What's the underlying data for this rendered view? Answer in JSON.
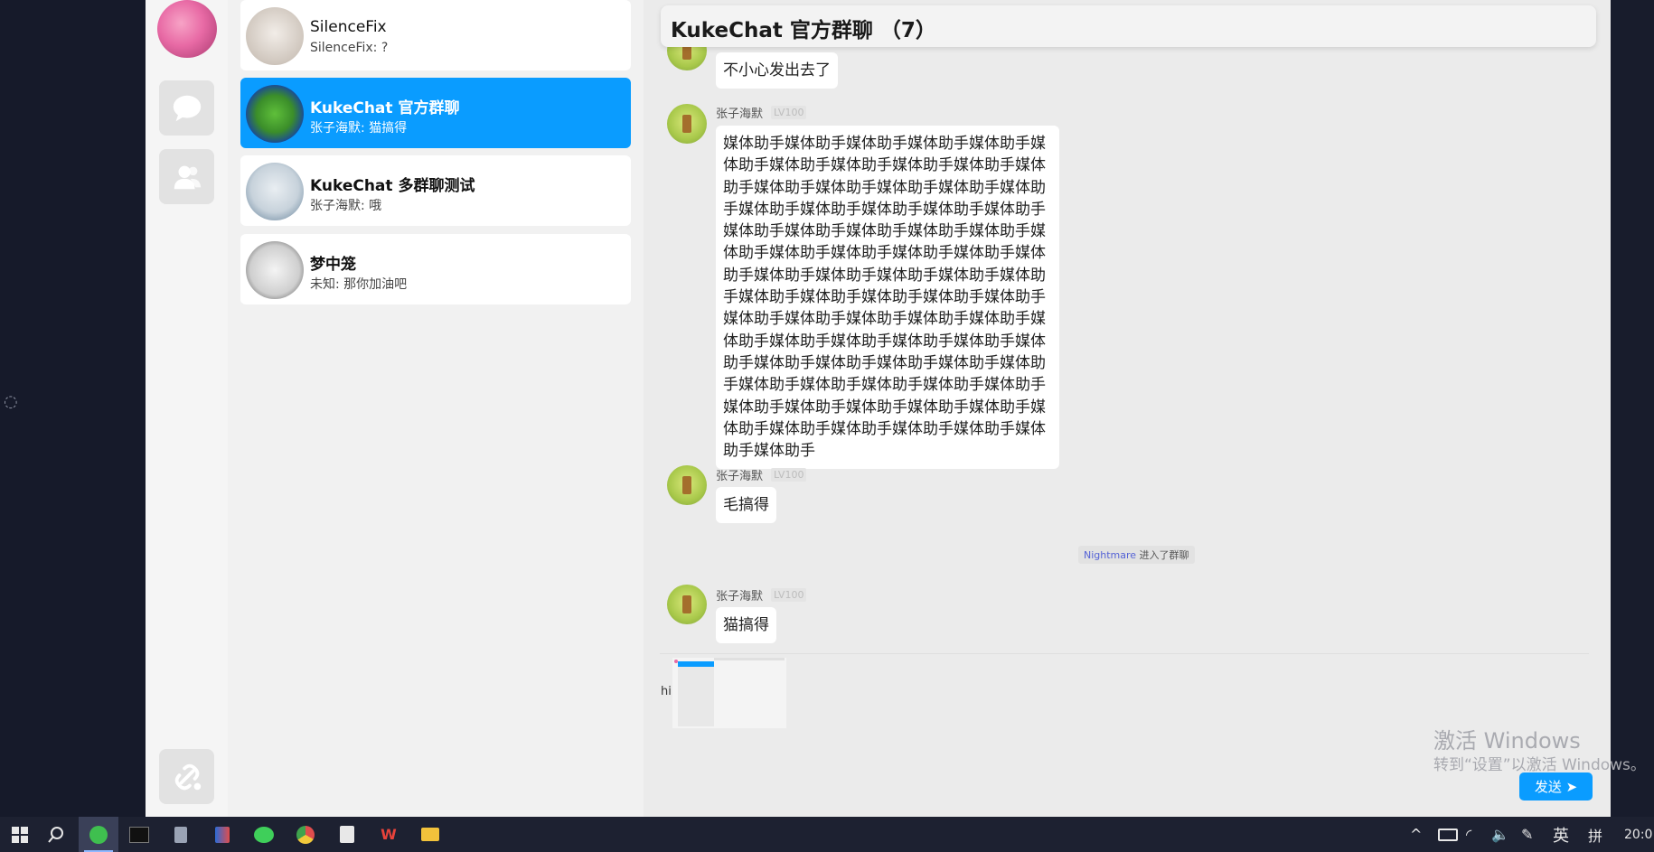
{
  "contacts": [
    {
      "name": "SilenceFix",
      "last": "SilenceFix: ?"
    },
    {
      "name": "KukeChat 官方群聊",
      "last": "张子海默: 猫搞得"
    },
    {
      "name": "KukeChat 多群聊测试",
      "last": "张子海默: 哦"
    },
    {
      "name": "梦中笼",
      "last": "未知: 那你加油吧"
    }
  ],
  "chat": {
    "title": "KukeChat 官方群聊  （7）",
    "messages": [
      {
        "text": "不小心发出去了"
      },
      {
        "sender": "张子海默",
        "level": "LV100",
        "text": "媒体助手媒体助手媒体助手媒体助手媒体助手媒体助手媒体助手媒体助手媒体助手媒体助手媒体助手媒体助手媒体助手媒体助手媒体助手媒体助手媒体助手媒体助手媒体助手媒体助手媒体助手媒体助手媒体助手媒体助手媒体助手媒体助手媒体助手媒体助手媒体助手媒体助手媒体助手媒体助手媒体助手媒体助手媒体助手媒体助手媒体助手媒体助手媒体助手媒体助手媒体助手媒体助手媒体助手媒体助手媒体助手媒体助手媒体助手媒体助手媒体助手媒体助手媒体助手媒体助手媒体助手媒体助手媒体助手媒体助手媒体助手媒体助手媒体助手媒体助手媒体助手媒体助手媒体助手媒体助手媒体助手媒体助手媒体助手媒体助手媒体助手媒体助手媒体助手媒体助手媒体助手媒体助手媒体助手"
      },
      {
        "sender": "张子海默",
        "level": "LV100",
        "text": "毛搞得"
      },
      {
        "sender": "张子海默",
        "level": "LV100",
        "text": "猫搞得"
      }
    ],
    "system_event": {
      "who": "Nightmare",
      "action": " 进入了群聊"
    },
    "input_text": "hi",
    "send_label": "发送 ➤"
  },
  "watermark": {
    "line1": "激活 Windows",
    "line2": "转到“设置”以激活 Windows。"
  },
  "taskbar": {
    "ime": "英",
    "ime_mode": "拼",
    "clock": "20:0"
  }
}
